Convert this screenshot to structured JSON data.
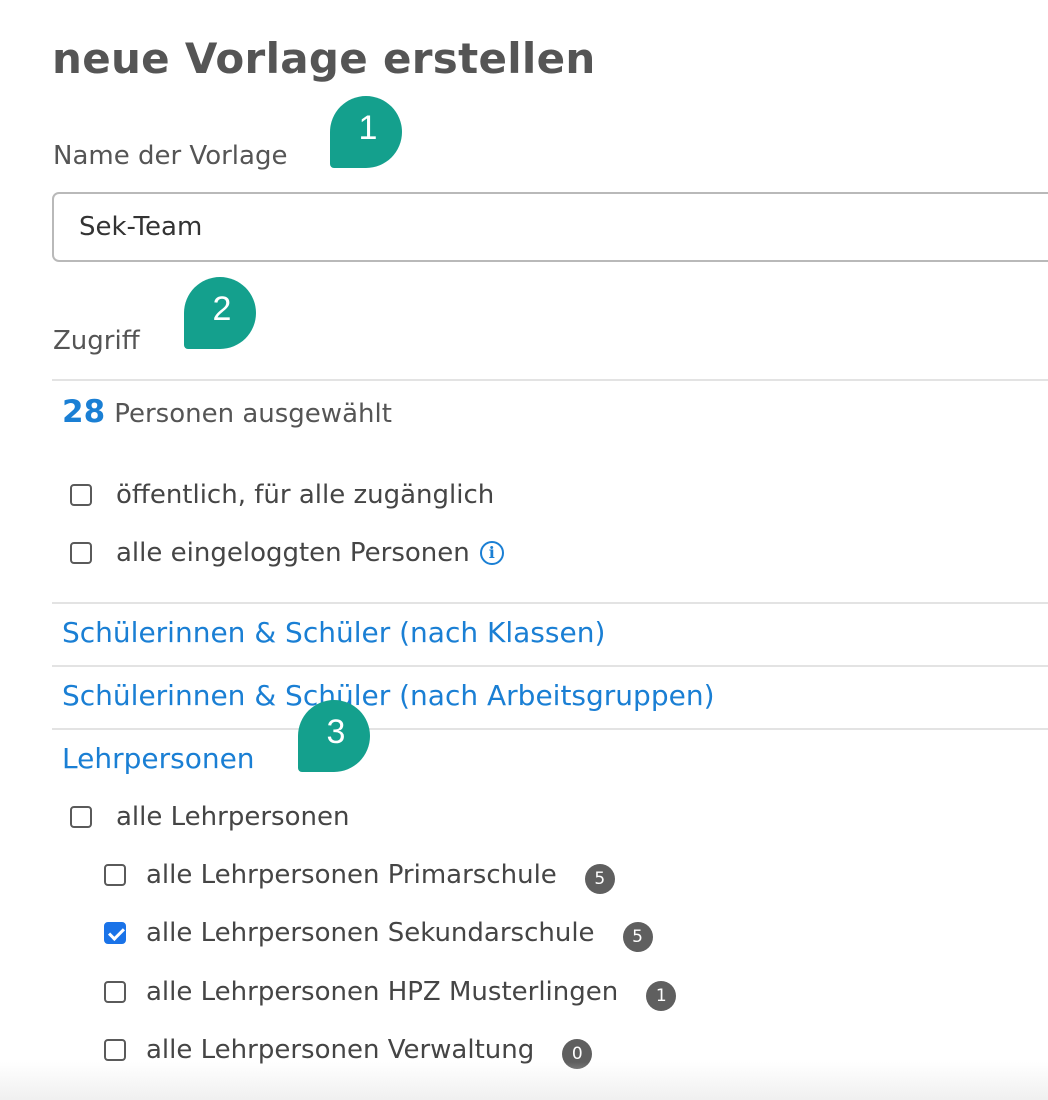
{
  "page": {
    "title": "neue Vorlage erstellen"
  },
  "name_field": {
    "label": "Name der Vorlage",
    "value": "Sek-Team"
  },
  "access": {
    "label": "Zugriff",
    "selected_count": "28",
    "selected_text": "Personen ausgewählt",
    "options": [
      {
        "label": "öffentlich, für alle zugänglich",
        "checked": false
      },
      {
        "label": "alle eingeloggten Personen",
        "checked": false,
        "icon": "info-icon",
        "icon_glyph": "i"
      }
    ]
  },
  "sections": {
    "students_by_class": "Schülerinnen & Schüler (nach Klassen)",
    "students_by_group": "Schülerinnen & Schüler (nach Arbeitsgruppen)",
    "teachers": "Lehrpersonen"
  },
  "teachers": {
    "all_label": "alle Lehrpersonen",
    "all_checked": false,
    "groups": [
      {
        "label": "alle Lehrpersonen Primarschule",
        "count": "5",
        "checked": false
      },
      {
        "label": "alle Lehrpersonen Sekundarschule",
        "count": "5",
        "checked": true
      },
      {
        "label": "alle Lehrpersonen HPZ Musterlingen",
        "count": "1",
        "checked": false
      },
      {
        "label": "alle Lehrpersonen Verwaltung",
        "count": "0",
        "checked": false
      }
    ]
  },
  "callouts": [
    "1",
    "2",
    "3"
  ],
  "colors": {
    "accent": "#1a7fd4",
    "callout": "#14a08d",
    "checkbox_checked": "#1a73e8",
    "badge": "#5f5f5f"
  }
}
